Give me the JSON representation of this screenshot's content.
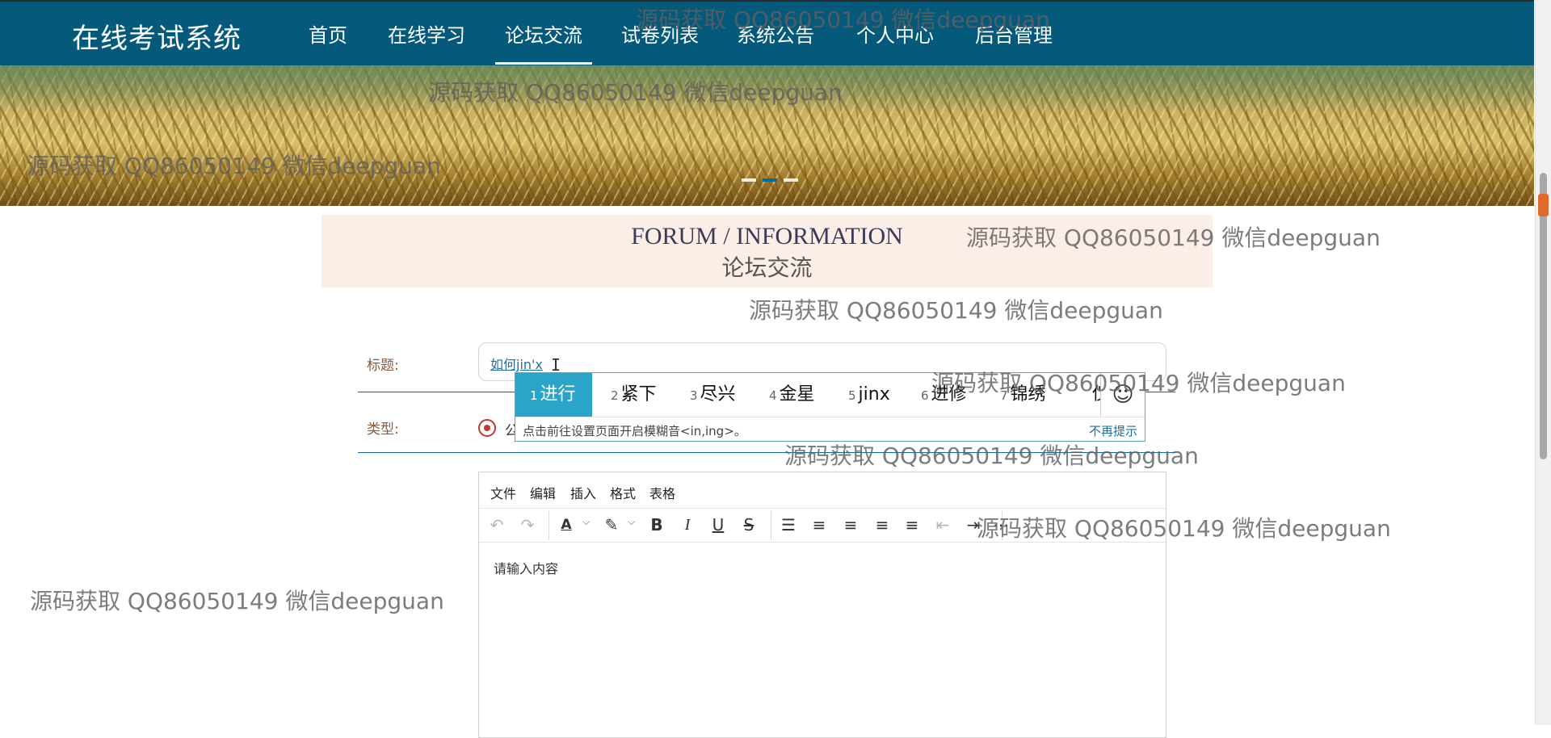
{
  "brand": "在线考试系统",
  "nav": {
    "items": [
      "首页",
      "在线学习",
      "论坛交流",
      "试卷列表",
      "系统公告",
      "个人中心",
      "后台管理"
    ],
    "active_index": 2
  },
  "banner": {
    "slide_count": 3,
    "active_slide": 1
  },
  "section": {
    "title_en": "FORUM / INFORMATION",
    "title_cn": "论坛交流"
  },
  "form": {
    "title_label": "标题:",
    "title_value": "如何jin'x",
    "type_label": "类型:",
    "type_option": "公"
  },
  "ime": {
    "candidates": [
      {
        "num": "1",
        "text": "进行"
      },
      {
        "num": "2",
        "text": "紧下"
      },
      {
        "num": "3",
        "text": "尽兴"
      },
      {
        "num": "4",
        "text": "金星"
      },
      {
        "num": "5",
        "text": "jinx"
      },
      {
        "num": "6",
        "text": "进修"
      },
      {
        "num": "7",
        "text": "锦绣"
      },
      {
        "num": "",
        "text": "仪"
      }
    ],
    "emoji_glyph": "☺",
    "hint": "点击前往设置页面开启模糊音<in,ing>。",
    "dismiss": "不再提示"
  },
  "editor": {
    "menus": [
      "文件",
      "编辑",
      "插入",
      "格式",
      "表格"
    ],
    "placeholder": "请输入内容",
    "tools": {
      "undo": "↶",
      "redo": "↷",
      "font_color": "A",
      "highlight": "✎",
      "bold": "B",
      "italic": "I",
      "underline": "U",
      "strike": "S",
      "line_height": "☰",
      "align_left": "≡",
      "align_center": "≡",
      "align_right": "≡",
      "justify": "≡",
      "outdent": "⇤",
      "indent": "⇥",
      "more": "⋯"
    }
  },
  "watermark": "源码获取 QQ86050149 微信deepguan",
  "colors": {
    "nav_bg": "#055a7c",
    "accent": "#2aa5c9",
    "section_bg": "#fbeee7",
    "radio": "#c0392b"
  }
}
